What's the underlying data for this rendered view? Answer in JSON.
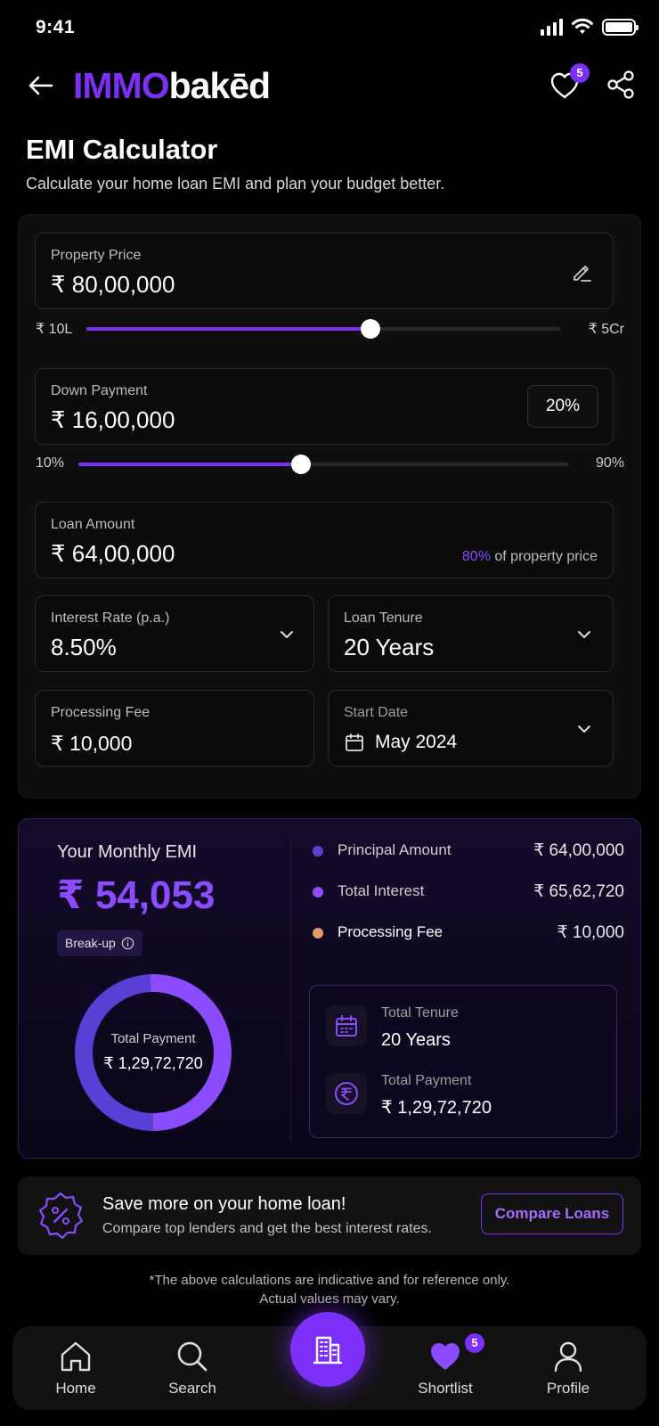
{
  "status": {
    "time": "9:41"
  },
  "header": {
    "logo_part1": "IMMO",
    "logo_part2": "bakēd",
    "favorites_count": "5",
    "icons": [
      "arrow-left-icon",
      "heart-icon",
      "share-icon"
    ]
  },
  "page": {
    "title": "EMI Calculator",
    "subtitle": "Calculate your home loan EMI and plan your budget better."
  },
  "calculator": {
    "property_price": {
      "label": "Property Price",
      "value": "₹ 80,00,000",
      "min_label": "₹ 10L",
      "max_label": "₹ 5Cr",
      "slider_fraction": 0.6
    },
    "down_payment": {
      "label": "Down Payment",
      "value": "₹ 16,00,000",
      "percent": "20%",
      "min_label": "10%",
      "max_label": "90%",
      "slider_fraction": 0.455
    },
    "loan_amount": {
      "label": "Loan Amount",
      "value": "₹ 64,00,000",
      "note_pct": "80%",
      "note_text": " of property price"
    },
    "interest_rate": {
      "label": "Interest Rate (p.a.)",
      "value": "8.50%"
    },
    "loan_tenure": {
      "label": "Loan Tenure",
      "value": "20 Years"
    },
    "processing_fee": {
      "label": "Processing Fee",
      "value": "₹ 10,000"
    },
    "start_date": {
      "label": "Start Date",
      "value": "May 2024"
    }
  },
  "emi": {
    "label": "Your Monthly EMI",
    "value": "₹ 54,053",
    "breakup_label": "Break-up",
    "donut_label": "Total Payment",
    "donut_value": "₹ 1,29,72,720",
    "legend": [
      {
        "name": "Principal Amount",
        "value": "₹ 64,00,000",
        "color": "#5a3fd6"
      },
      {
        "name": "Total Interest",
        "value": "₹ 65,62,720",
        "color": "#8b4bff"
      },
      {
        "name": "Processing Fee",
        "value": "₹ 10,000",
        "color": "#e59a6a"
      }
    ],
    "summary": {
      "tenure_label": "Total Tenure",
      "tenure_value": "20 Years",
      "payment_label": "Total Payment",
      "payment_value": "₹ 1,29,72,720"
    }
  },
  "promo": {
    "title": "Save more on your home loan!",
    "subtitle": "Compare top lenders and get the best interest rates.",
    "button": "Compare Loans"
  },
  "disclaimer": {
    "line1": "*The above calculations are indicative and for reference only.",
    "line2": "Actual values may vary."
  },
  "nav": {
    "items": [
      {
        "label": "Home"
      },
      {
        "label": "Search"
      },
      {
        "label": "Shortlist"
      },
      {
        "label": "Profile"
      }
    ],
    "shortlist_count": "5"
  },
  "colors": {
    "accent": "#7b2ff7",
    "accent_light": "#8b4bff",
    "background": "#000000"
  }
}
